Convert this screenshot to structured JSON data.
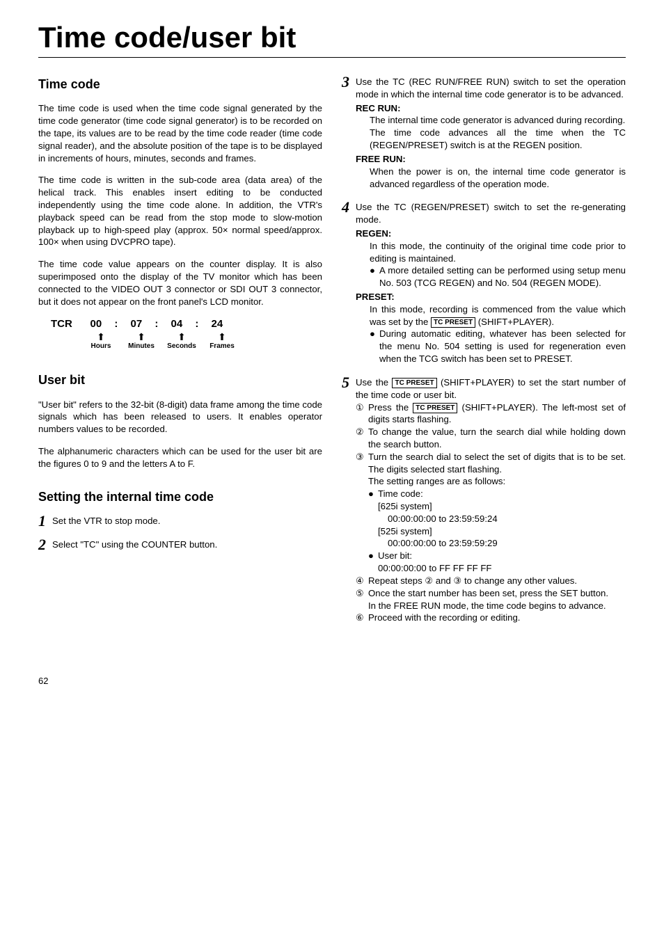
{
  "main_title": "Time code/user bit",
  "left": {
    "h_timecode": "Time code",
    "p1": "The time code is used when the time code signal generated by the time code generator (time code signal generator) is to be recorded on the tape, its values are to be read by the time code reader (time code signal reader), and the absolute position of the tape is to be displayed in increments of hours, minutes, seconds and frames.",
    "p2": "The time code is written in the sub-code area (data area) of the helical track. This enables insert editing to be conducted independently using the time code alone. In addition, the VTR's playback speed can be read from the stop mode to slow-motion playback up to high-speed play (approx. 50× normal speed/approx. 100× when using DVCPRO tape).",
    "p3": "The time code value appears on the counter display.  It is also superimposed onto the display of the TV monitor which has been connected to the VIDEO OUT 3 connector or SDI OUT 3 connector, but it does not appear on the front panel's LCD monitor.",
    "tcr": {
      "label": "TCR",
      "d1": "00",
      "d2": "07",
      "d3": "04",
      "d4": "24",
      "l1": "Hours",
      "l2": "Minutes",
      "l3": "Seconds",
      "l4": "Frames"
    },
    "h_userbit": "User bit",
    "p4": "\"User bit\" refers to the 32-bit (8-digit) data frame among the time code signals which has been released to users. It enables operator numbers values to be recorded.",
    "p5": "The alphanumeric characters which can be used for the user bit are the figures 0 to 9 and the letters A to F.",
    "h_setting": "Setting the internal time code",
    "step1": "Set the VTR to stop mode.",
    "step2": "Select \"TC\" using the COUNTER button."
  },
  "right": {
    "s3": {
      "lead": "Use the TC (REC RUN/FREE RUN) switch to set the operation mode in which the internal time code generator is to be advanced.",
      "rec_label": "REC RUN:",
      "rec_p1": "The internal time code generator is advanced during recording.",
      "rec_p2": "The time code advances all the time when the TC (REGEN/PRESET) switch is at the REGEN position.",
      "free_label": "FREE RUN:",
      "free_p": "When the power is on, the internal time code generator is advanced regardless of the operation mode."
    },
    "s4": {
      "lead": "Use the TC (REGEN/PRESET) switch to set the re-generating mode.",
      "regen_label": "REGEN:",
      "regen_p": "In this mode, the continuity of the original time code prior to editing is maintained.",
      "regen_b": "A more detailed setting can be performed using setup menu No. 503 (TCG REGEN) and No. 504 (REGEN MODE).",
      "preset_label": "PRESET:",
      "preset_p_a": "In this mode, recording is commenced from the value which was set by the ",
      "preset_box": "TC PRESET",
      "preset_p_b": " (SHIFT+PLAYER).",
      "preset_b": "During automatic editing, whatever has been selected for the menu No. 504 setting is used for regeneration even when the TCG switch has been set to PRESET."
    },
    "s5": {
      "lead_a": "Use the ",
      "lead_box": "TC PRESET",
      "lead_b": " (SHIFT+PLAYER) to set the start number of the time code or user bit.",
      "n1_a": "Press the ",
      "n1_box": "TC PRESET",
      "n1_b": " (SHIFT+PLAYER). The left-most set of digits starts flashing.",
      "n2": "To change the value, turn the search dial while holding down the search button.",
      "n3a": "Turn the search dial to select the set of digits that is to be set.  The digits selected start flashing.",
      "n3b": "The setting ranges are as follows:",
      "tc_label": "Time code:",
      "sys625": "[625i system]",
      "rng625": "00:00:00:00 to 23:59:59:24",
      "sys525": "[525i system]",
      "rng525": "00:00:00:00 to 23:59:59:29",
      "ub_label": "User bit:",
      "ub_rng": "00:00:00:00 to FF FF FF FF",
      "n4": "Repeat steps ② and ③ to change any other values.",
      "n5a": "Once the start number has been set, press the SET button.",
      "n5b": "In the FREE RUN mode, the time code begins to advance.",
      "n6": "Proceed with the recording or editing."
    }
  },
  "page_number": "62"
}
